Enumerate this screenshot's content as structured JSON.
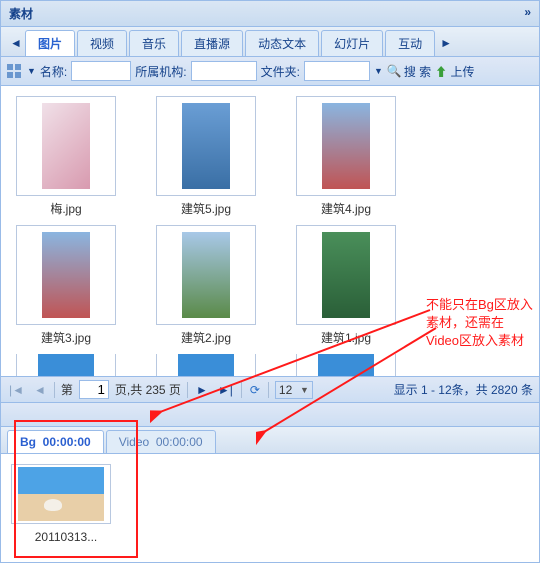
{
  "panel": {
    "title": "素材"
  },
  "tabs": {
    "items": [
      "图片",
      "视频",
      "音乐",
      "直播源",
      "动态文本",
      "幻灯片",
      "互动"
    ],
    "active_index": 0
  },
  "toolbar": {
    "name_label": "名称:",
    "org_label": "所属机构:",
    "folder_label": "文件夹:",
    "search_label": "搜 索",
    "upload_label": "上传"
  },
  "thumbs": {
    "row1": [
      {
        "caption": "梅.jpg"
      },
      {
        "caption": "建筑5.jpg"
      },
      {
        "caption": "建筑4.jpg"
      }
    ],
    "row2": [
      {
        "caption": "建筑3.jpg"
      },
      {
        "caption": "建筑2.jpg"
      },
      {
        "caption": "建筑1.jpg"
      }
    ]
  },
  "pager": {
    "prefix": "第",
    "current": "1",
    "suffix": "页,共 235 页",
    "page_size": "12",
    "info": "显示 1 - 12条，共 2820 条"
  },
  "bottom_tabs": {
    "items": [
      {
        "label": "Bg",
        "time": "00:00:00"
      },
      {
        "label": "Video",
        "time": "00:00:00"
      }
    ],
    "active_index": 0
  },
  "clip": {
    "caption": "20110313..."
  },
  "annotation": {
    "text": "不能只在Bg区放入素材，还需在Video区放入素材"
  }
}
